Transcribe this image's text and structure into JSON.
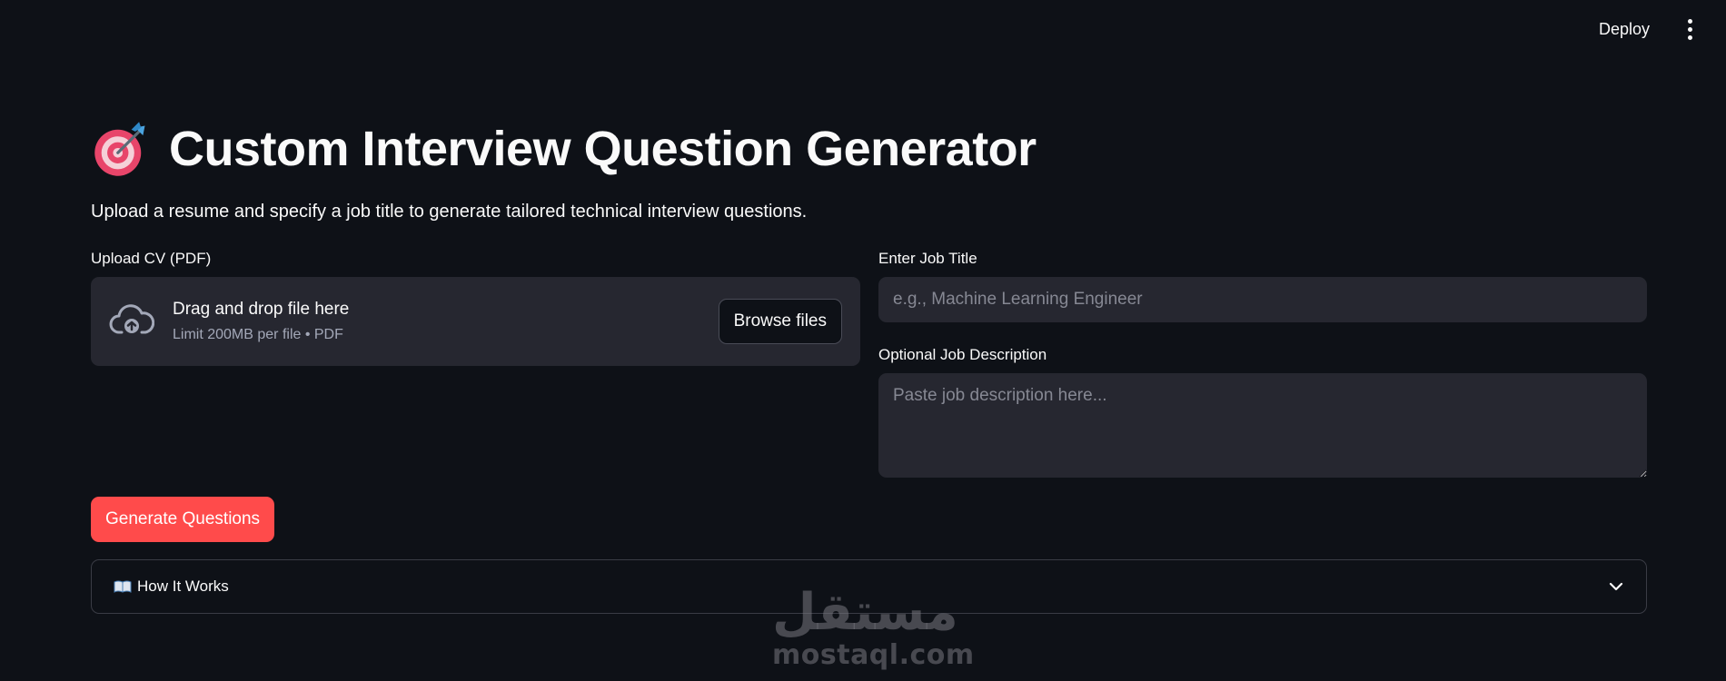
{
  "header": {
    "deploy_label": "Deploy",
    "menu_icon": "kebab-menu-icon"
  },
  "page": {
    "title_icon": "target-dart-icon",
    "title": "Custom Interview Question Generator",
    "subtitle": "Upload a resume and specify a job title to generate tailored technical interview questions."
  },
  "uploader": {
    "label": "Upload CV (PDF)",
    "icon": "cloud-upload-icon",
    "drag_text": "Drag and drop file here",
    "limit_text": "Limit 200MB per file • PDF",
    "browse_label": "Browse files"
  },
  "job_title": {
    "label": "Enter Job Title",
    "value": "",
    "placeholder": "e.g., Machine Learning Engineer"
  },
  "job_description": {
    "label": "Optional Job Description",
    "value": "",
    "placeholder": "Paste job description here..."
  },
  "actions": {
    "generate_label": "Generate Questions"
  },
  "expander": {
    "icon": "open-book-icon",
    "label": "How It Works",
    "expanded": false
  },
  "watermark": {
    "arabic": "مستقل",
    "latin": "mostaql.com"
  },
  "colors": {
    "background": "#0e1117",
    "surface": "#262730",
    "primary": "#ff4b4b",
    "text": "#fafafa",
    "muted_text": "#a3a8b8"
  }
}
